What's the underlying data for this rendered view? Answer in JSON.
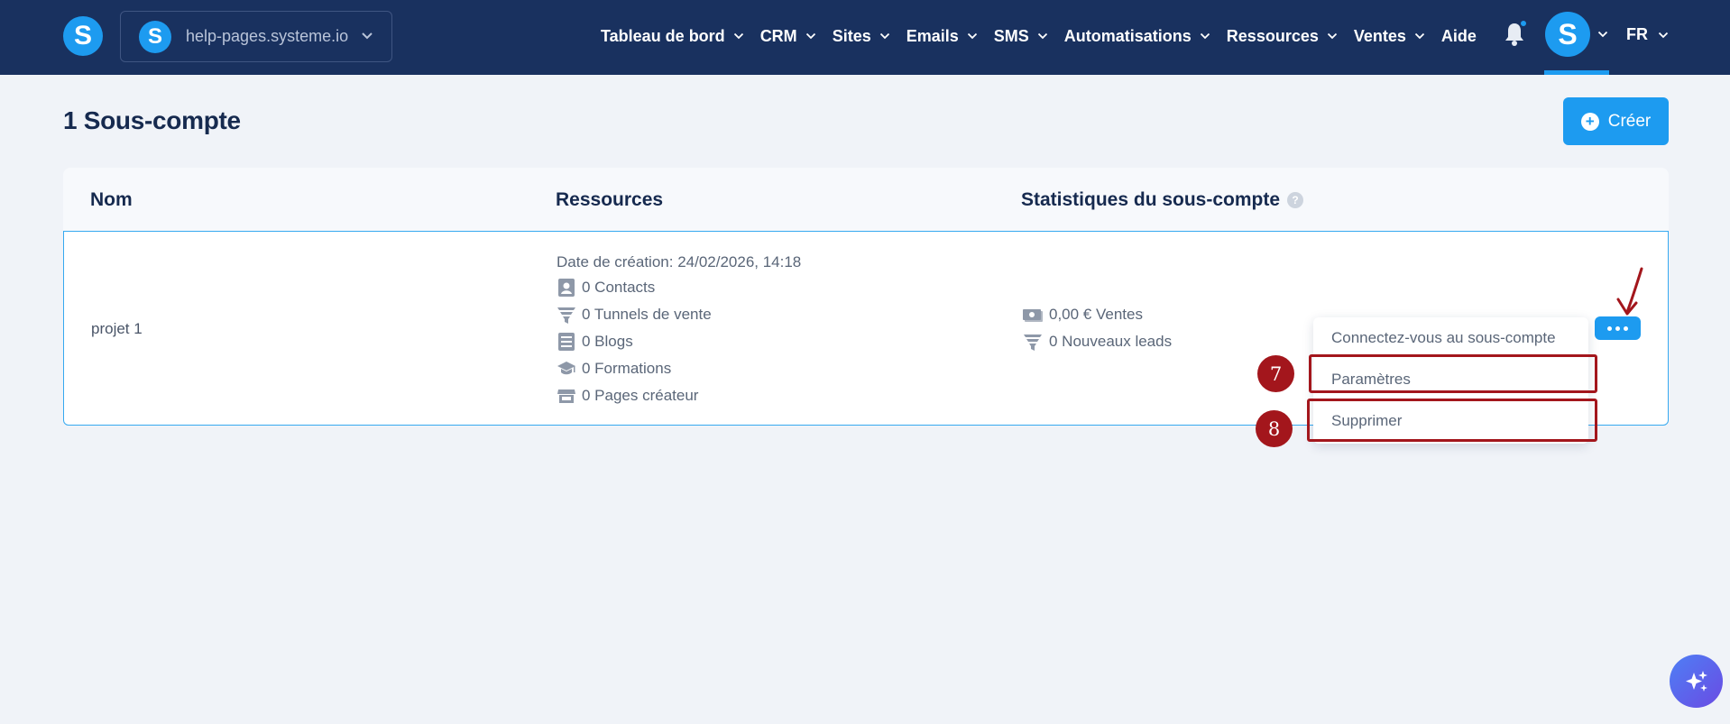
{
  "topbar": {
    "workspace_name": "help-pages.systeme.io",
    "nav": [
      {
        "label": "Tableau de bord",
        "has_chevron": true
      },
      {
        "label": "CRM",
        "has_chevron": true
      },
      {
        "label": "Sites",
        "has_chevron": true
      },
      {
        "label": "Emails",
        "has_chevron": true
      },
      {
        "label": "SMS",
        "has_chevron": true
      },
      {
        "label": "Automatisations",
        "has_chevron": true
      },
      {
        "label": "Ressources",
        "has_chevron": true
      },
      {
        "label": "Ventes",
        "has_chevron": true
      },
      {
        "label": "Aide",
        "has_chevron": false
      }
    ],
    "language": "FR",
    "logo_letter": "S",
    "avatar_letter": "S"
  },
  "page": {
    "title": "1 Sous-compte",
    "create_label": "Créer"
  },
  "table": {
    "headers": {
      "name": "Nom",
      "resources": "Ressources",
      "stats": "Statistiques du sous-compte"
    },
    "row": {
      "name": "projet 1",
      "created": "Date de création: 24/02/2026, 14:18",
      "resources": [
        {
          "icon": "contact-icon",
          "text": "0 Contacts"
        },
        {
          "icon": "funnel-icon",
          "text": "0 Tunnels de vente"
        },
        {
          "icon": "blog-icon",
          "text": "0 Blogs"
        },
        {
          "icon": "graduation-cap-icon",
          "text": "0 Formations"
        },
        {
          "icon": "store-icon",
          "text": "0 Pages créateur"
        }
      ],
      "stats": [
        {
          "icon": "money-icon",
          "text": "0,00 € Ventes"
        },
        {
          "icon": "funnel-icon",
          "text": "0 Nouveaux leads"
        }
      ]
    }
  },
  "dropdown": {
    "items": [
      "Connectez-vous au sous-compte",
      "Paramètres",
      "Supprimer"
    ]
  },
  "annotations": {
    "steps": [
      "7",
      "8"
    ],
    "color": "#a3161c"
  },
  "colors": {
    "navbar": "#19315f",
    "accent": "#1d9bf0",
    "background": "#f0f3f8"
  }
}
